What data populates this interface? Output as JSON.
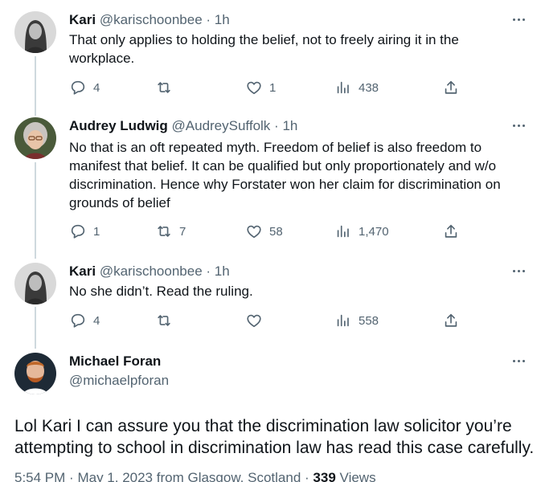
{
  "tweets": [
    {
      "name": "Kari",
      "handle": "@karischoonbee",
      "separator": "·",
      "time": "1h",
      "text": "That only applies to holding the belief, not to freely airing it in the workplace.",
      "replies": "4",
      "retweets": "",
      "likes": "1",
      "views": "438"
    },
    {
      "name": "Audrey Ludwig",
      "handle": "@AudreySuffolk",
      "separator": "·",
      "time": "1h",
      "text": "No that is an oft repeated myth. Freedom of belief is also freedom to manifest that belief. It can be qualified but only proportionately and w/o discrimination. Hence why Forstater won her claim for discrimination on grounds of belief",
      "replies": "1",
      "retweets": "7",
      "likes": "58",
      "views": "1,470"
    },
    {
      "name": "Kari",
      "handle": "@karischoonbee",
      "separator": "·",
      "time": "1h",
      "text": "No she didn’t. Read the ruling.",
      "replies": "4",
      "retweets": "",
      "likes": "",
      "views": "558"
    }
  ],
  "main_tweet": {
    "name": "Michael Foran",
    "handle": "@michaelpforan",
    "text": "Lol Kari I can assure you that the discrimination law solicitor you’re attempting to school in discrimination law has read this case carefully.",
    "time": "5:54 PM",
    "separator": "·",
    "date": "May 1, 2023",
    "location": "from Glasgow, Scotland",
    "views_count": "339",
    "views_label": "Views"
  },
  "icons": [
    "more-icon",
    "reply-icon",
    "retweet-icon",
    "like-icon",
    "views-icon",
    "share-icon"
  ],
  "colors": {
    "text": "#0f1419",
    "secondary": "#536471",
    "thread_line": "#cfd9de",
    "background": "#ffffff"
  }
}
